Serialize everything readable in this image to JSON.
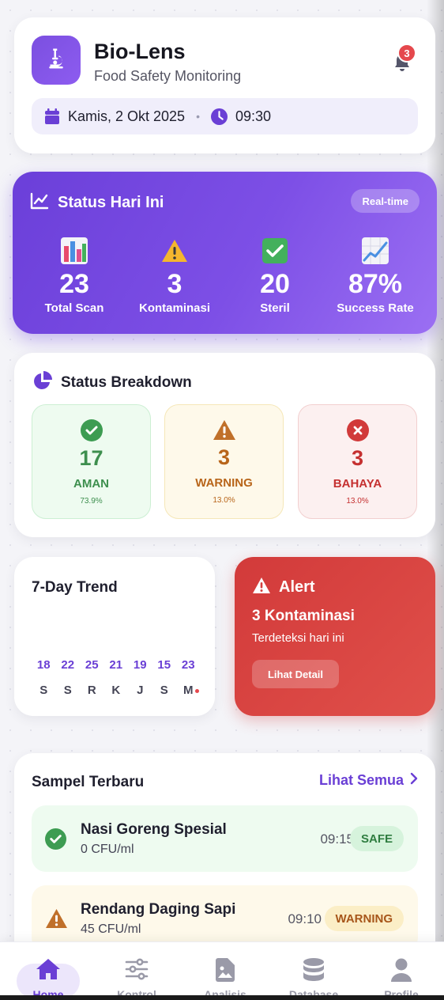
{
  "app": {
    "title": "Bio-Lens",
    "subtitle": "Food Safety Monitoring",
    "notification_count": "3",
    "date": "Kamis, 2 Okt 2025",
    "separator": "•",
    "time": "09:30"
  },
  "status": {
    "title": "Status Hari Ini",
    "badge": "Real-time",
    "stats": [
      {
        "value": "23",
        "label": "Total Scan",
        "icon": "bar-chart-icon"
      },
      {
        "value": "3",
        "label": "Kontaminasi",
        "icon": "warning-icon"
      },
      {
        "value": "20",
        "label": "Steril",
        "icon": "check-box-icon"
      },
      {
        "value": "87%",
        "label": "Success Rate",
        "icon": "trend-chart-icon"
      }
    ]
  },
  "breakdown": {
    "title": "Status Breakdown",
    "items": [
      {
        "value": "17",
        "label": "AMAN",
        "percent": "73.9%"
      },
      {
        "value": "3",
        "label": "WARNING",
        "percent": "13.0%"
      },
      {
        "value": "3",
        "label": "BAHAYA",
        "percent": "13.0%"
      }
    ]
  },
  "trend": {
    "title": "7-Day Trend",
    "values": [
      "18",
      "22",
      "25",
      "21",
      "19",
      "15",
      "23"
    ],
    "days": [
      "S",
      "S",
      "R",
      "K",
      "J",
      "S",
      "M"
    ]
  },
  "alert": {
    "title": "Alert",
    "headline": "3 Kontaminasi",
    "subtitle": "Terdeteksi hari ini",
    "button": "Lihat Detail"
  },
  "samples": {
    "title": "Sampel Terbaru",
    "see_all": "Lihat Semua",
    "items": [
      {
        "name": "Nasi Goreng Spesial",
        "cfu": "0 CFU/ml",
        "time": "09:15",
        "status": "SAFE"
      },
      {
        "name": "Rendang Daging Sapi",
        "cfu": "45 CFU/ml",
        "time": "09:10",
        "status": "WARNING"
      }
    ]
  },
  "nav": {
    "items": [
      {
        "label": "Home",
        "icon": "home-icon"
      },
      {
        "label": "Kontrol",
        "icon": "sliders-icon"
      },
      {
        "label": "Analisis",
        "icon": "image-file-icon"
      },
      {
        "label": "Database",
        "icon": "database-icon"
      },
      {
        "label": "Profile",
        "icon": "user-icon"
      }
    ]
  },
  "colors": {
    "primary": "#6b3fd9",
    "safe": "#3d8f4e",
    "warning": "#b8651a",
    "danger": "#c53030"
  }
}
